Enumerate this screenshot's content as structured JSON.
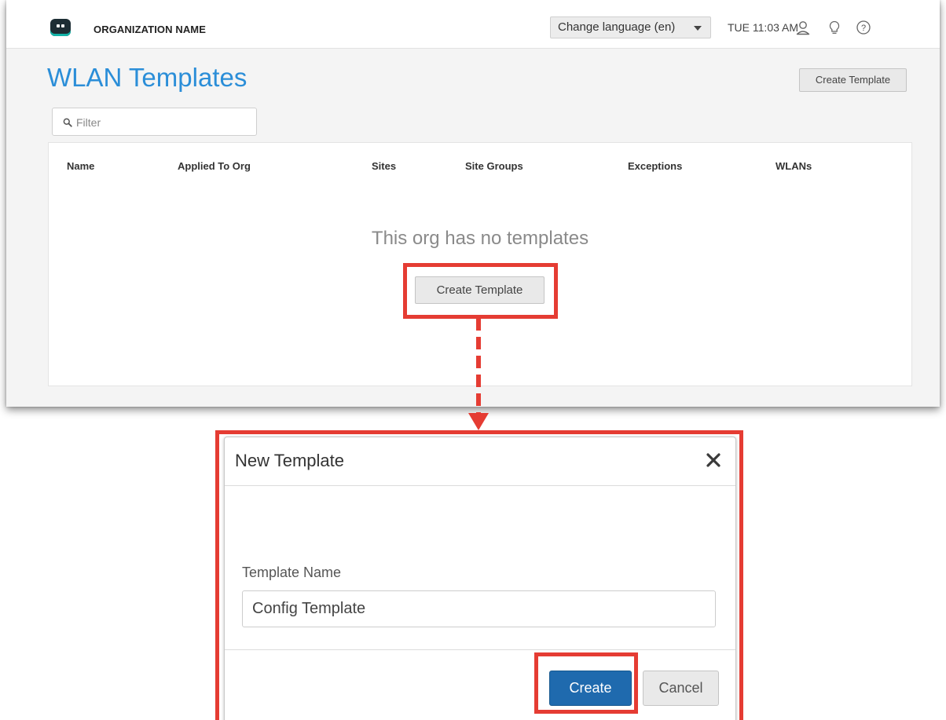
{
  "topbar": {
    "org_name": "ORGANIZATION NAME",
    "language_select": "Change language (en)",
    "clock": "TUE 11:03 AM",
    "icons": [
      "user-icon",
      "lightbulb-icon",
      "help-icon"
    ]
  },
  "page": {
    "title": "WLAN Templates",
    "create_template_label": "Create Template",
    "filter_placeholder": "Filter"
  },
  "table": {
    "columns": [
      "Name",
      "Applied To Org",
      "Sites",
      "Site Groups",
      "Exceptions",
      "WLANs"
    ],
    "empty_message": "This org has no templates",
    "empty_create_label": "Create Template"
  },
  "modal": {
    "title": "New Template",
    "field_label": "Template Name",
    "field_value": "Config Template",
    "create_label": "Create",
    "cancel_label": "Cancel"
  },
  "colors": {
    "title_blue": "#2b8ed8",
    "highlight_red": "#e53c33",
    "primary_button": "#1f6aae"
  }
}
